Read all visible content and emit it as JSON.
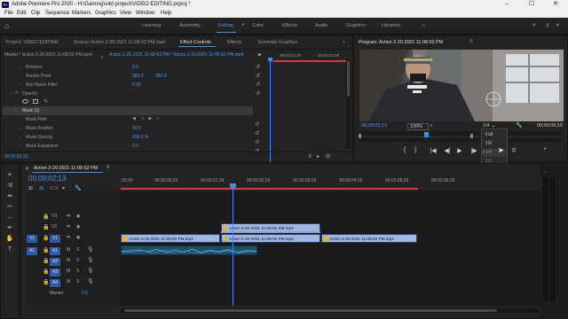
{
  "titlebar": {
    "app_icon_text": "Pr",
    "title": "Adobe Premiere Pro 2020 - H:\\Gaming\\s4d project\\VIDEO EDITING.prproj *",
    "minimize": "–",
    "maximize": "☐",
    "close": "✕"
  },
  "menubar": {
    "items": [
      "File",
      "Edit",
      "Clip",
      "Sequence",
      "Markers",
      "Graphics",
      "View",
      "Window",
      "Help"
    ]
  },
  "workspaces": {
    "items": [
      "Learning",
      "Assembly",
      "Editing",
      "Color",
      "Effects",
      "Audio",
      "Graphics",
      "Libraries"
    ],
    "active": "Editing",
    "more": "»"
  },
  "source_panel": {
    "tabs": [
      "Project: VIDEO EDITING",
      "Source: Action 2-20-2021 11-08-52 PM.mp4",
      "Effect Controls",
      "Effects",
      "Essential Graphics"
    ],
    "active_tab": "Effect Controls",
    "more": "»",
    "master_label": "Master * Action 2-20-2021 11-08-52 PM.mp4",
    "clip_label": "Action 2-20-2021 11-08-52 PM * Action 2-20-2021 11-08-52 PM.mp4",
    "mini_timecodes": [
      "00;00;02;29",
      "00;00;03;29"
    ],
    "rows": [
      {
        "label": "Rotation",
        "value": "0.0",
        "value2": ""
      },
      {
        "label": "Anchor Point",
        "value": "683.0",
        "value2": "384.0"
      },
      {
        "label": "Anti-flicker Filter",
        "value": "0.00",
        "value2": ""
      },
      {
        "label": "Opacity",
        "value": "",
        "value2": ""
      },
      {
        "label": "Mask (1)",
        "value": "",
        "value2": ""
      },
      {
        "label": "Mask Path",
        "value": "",
        "value2": ""
      },
      {
        "label": "Mask Feather",
        "value": "10.0",
        "value2": ""
      },
      {
        "label": "Mask Opacity",
        "value": "100.0 %",
        "value2": ""
      },
      {
        "label": "Mask Expansion",
        "value": "0.0",
        "value2": ""
      }
    ],
    "fx_label": "fx",
    "footer_timecode": "00;00;02;13"
  },
  "program_monitor": {
    "title": "Program: Action 2-20-2021 11-08-52 PM",
    "menu_icon": "≡",
    "timecode": "00;00;02;13",
    "zoom": "100%",
    "duration": "00;00;06;16",
    "resolution": "1/4",
    "resolution_options": [
      "Full",
      "1/2",
      "1/4",
      "1/8"
    ],
    "selected_option": "1/4",
    "controls": [
      "{",
      "}",
      "|◀",
      "◀|",
      "▶",
      "|▶",
      "▶|"
    ],
    "playhead_fraction": 0.33
  },
  "timeline": {
    "tab_title": "Action 2-20-2021 11-08-52 PM",
    "menu_icon": "≡",
    "close": "✕",
    "timecode": "00;00;02;13",
    "ruler_labels": [
      ";00;00",
      "00;00;00;29",
      "00;00;01;29",
      "00;00;02;29",
      "00;00;03;29",
      "00;00;04;29",
      "00;00;05;29",
      "00;00;06;29"
    ],
    "video_tracks": [
      {
        "target": "",
        "name": "V3"
      },
      {
        "target": "",
        "name": "V2"
      },
      {
        "target": "V1",
        "name": "V1"
      }
    ],
    "audio_tracks": [
      {
        "target": "A1",
        "name": "A1",
        "m": "M",
        "s": "S"
      },
      {
        "target": "",
        "name": "A2",
        "m": "M",
        "s": "S"
      },
      {
        "target": "",
        "name": "A3",
        "m": "M",
        "s": "S"
      },
      {
        "target": "",
        "name": "A4",
        "m": "M",
        "s": "S"
      }
    ],
    "master_label": "Master",
    "master_value": "0.0",
    "clips_v2": [
      "Action 2-20-2021 11-08-52 PM.mp4"
    ],
    "clips_v1": [
      "Action 2-20-2021 11-08-52 PM.mp4",
      "Action 2-20-2021 11-08-52 PM.mp4",
      "Action 2-20-2021 11-08-52 PM.mp4"
    ]
  },
  "colors": {
    "accent": "#3d8ef0",
    "video_clip": "#9fb7e6",
    "audio_clip": "#1e4d6b",
    "work_area": "#d23b3b",
    "fx_badge": "#e3b22a"
  }
}
